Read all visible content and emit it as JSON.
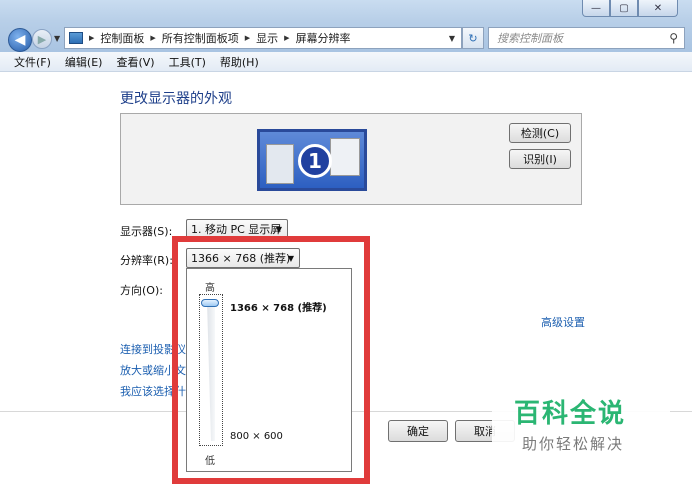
{
  "window": {
    "minimize_icon": "minimize-icon",
    "maximize_icon": "maximize-icon",
    "close_icon": "close-icon",
    "min_glyph": "—",
    "max_glyph": "▢",
    "close_glyph": "✕"
  },
  "toolbar": {
    "back_glyph": "◀",
    "forward_glyph": "▶",
    "refresh_glyph": "↻",
    "search_glyph": "⚲"
  },
  "address_bar": {
    "breadcrumbs": [
      "控制面板",
      "所有控制面板项",
      "显示",
      "屏幕分辨率"
    ]
  },
  "search": {
    "placeholder": "搜索控制面板"
  },
  "menu": [
    "文件(F)",
    "编辑(E)",
    "查看(V)",
    "工具(T)",
    "帮助(H)"
  ],
  "page": {
    "heading": "更改显示器的外观",
    "monitor_number": "1",
    "detect_button": "检测(C)",
    "identify_button": "识别(I)",
    "display_label": "显示器(S):",
    "display_value": "1. 移动 PC 显示屏",
    "resolution_label": "分辨率(R):",
    "resolution_value": "1366 × 768 (推荐)",
    "orientation_label": "方向(O):",
    "advanced_link": "高级设置",
    "links": [
      "连接到投影仪 (",
      "放大或缩小文本",
      "我应该选择什么"
    ],
    "ok_button": "确定",
    "cancel_button": "取消"
  },
  "resolution_popup": {
    "high_label": "高",
    "low_label": "低",
    "max_resolution": "1366 × 768 (推荐)",
    "min_resolution": "800 × 600",
    "slider_level": 1.0
  },
  "watermark": {
    "title": "百科全说",
    "subtitle": "助你轻松解决"
  },
  "colors": {
    "highlight": "#e03b3b",
    "link": "#1c5fb0",
    "heading": "#1e3f8a",
    "watermark": "#2bb673"
  }
}
